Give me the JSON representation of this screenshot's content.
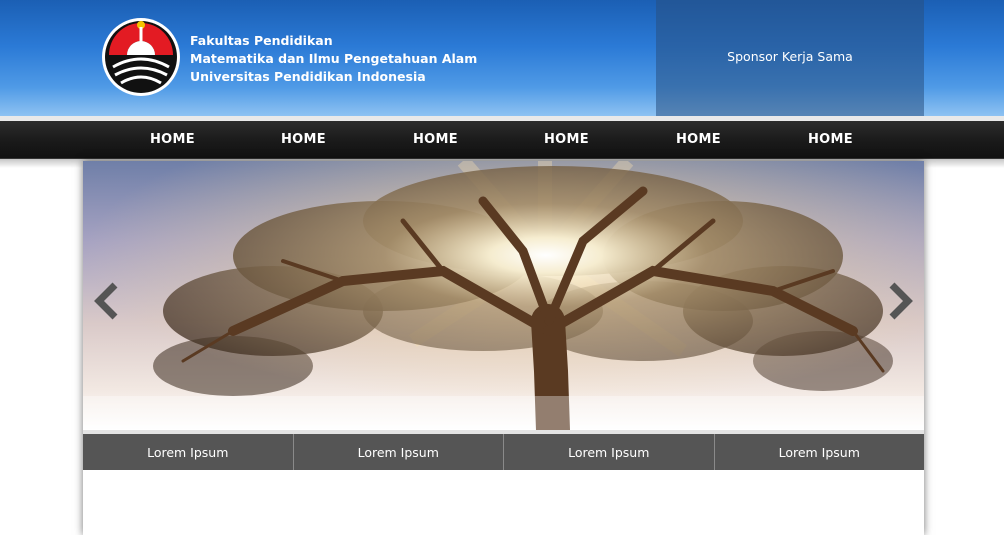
{
  "header": {
    "title_lines": [
      "Fakultas Pendidikan",
      "Matematika dan Ilmu Pengetahuan Alam",
      "Universitas Pendidikan Indonesia"
    ],
    "sponsor": "Sponsor Kerja Sama",
    "logo_icon": "upi-logo-icon"
  },
  "nav": {
    "items": [
      "HOME",
      "HOME",
      "HOME",
      "HOME",
      "HOME",
      "HOME"
    ]
  },
  "slider": {
    "image": "tree-sunburst-image",
    "prev_icon": "chevron-left-icon",
    "next_icon": "chevron-right-icon"
  },
  "tabs": [
    "Lorem Ipsum",
    "Lorem Ipsum",
    "Lorem Ipsum",
    "Lorem Ipsum"
  ],
  "colors": {
    "header_blue": "#2b7ad6",
    "nav_dark": "#1a1a1a",
    "tab_gray": "#555555"
  }
}
